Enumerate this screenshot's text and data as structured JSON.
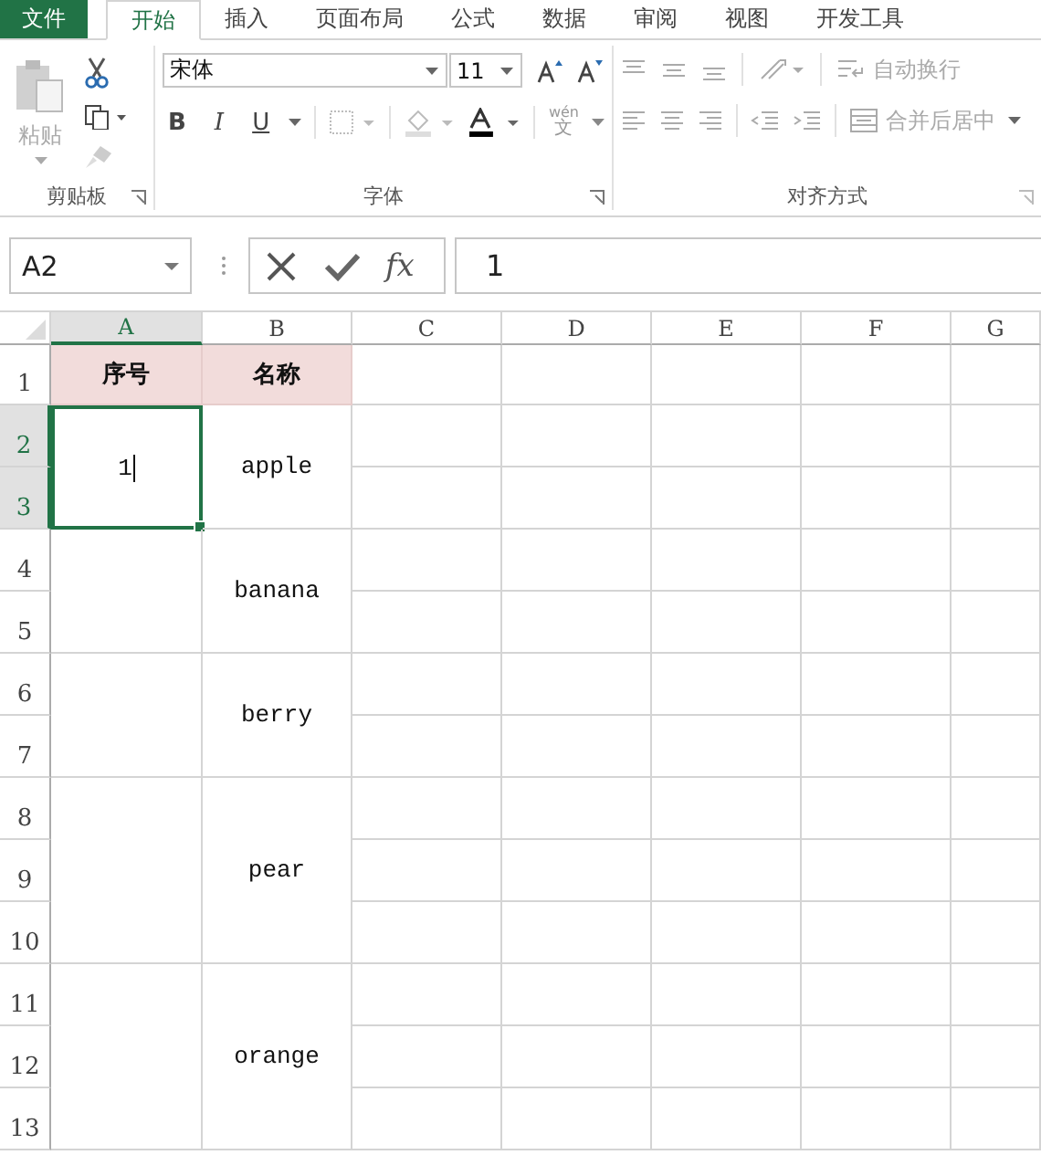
{
  "tabs": [
    {
      "label": "文件",
      "kind": "file",
      "selected": false
    },
    {
      "label": "开始",
      "kind": "tab",
      "selected": true
    },
    {
      "label": "插入",
      "kind": "tab",
      "selected": false
    },
    {
      "label": "页面布局",
      "kind": "tab",
      "selected": false
    },
    {
      "label": "公式",
      "kind": "tab",
      "selected": false
    },
    {
      "label": "数据",
      "kind": "tab",
      "selected": false
    },
    {
      "label": "审阅",
      "kind": "tab",
      "selected": false
    },
    {
      "label": "视图",
      "kind": "tab",
      "selected": false
    },
    {
      "label": "开发工具",
      "kind": "tab",
      "selected": false
    }
  ],
  "ribbon": {
    "clipboard": {
      "paste": "粘贴",
      "label": "剪贴板",
      "disabled": true
    },
    "font": {
      "name": "宋体",
      "size": "11",
      "bold": "B",
      "italic": "I",
      "underline": "U",
      "phonetic_top": "wén",
      "phonetic": "文",
      "label": "字体"
    },
    "alignment": {
      "wrap": "自动换行",
      "merge": "合并后居中",
      "label": "对齐方式",
      "disabled": true
    }
  },
  "formula_bar": {
    "name_box": "A2",
    "function_label": "fx",
    "value": "1"
  },
  "sheet": {
    "columns": [
      {
        "label": "A",
        "selected": true
      },
      {
        "label": "B",
        "selected": false
      },
      {
        "label": "C",
        "selected": false
      },
      {
        "label": "D",
        "selected": false
      },
      {
        "label": "E",
        "selected": false
      },
      {
        "label": "F",
        "selected": false
      },
      {
        "label": "G",
        "selected": false
      }
    ],
    "header_row": {
      "label": "1",
      "cells": [
        "序号",
        "名称"
      ]
    },
    "blocks": [
      {
        "rows": [
          {
            "label": "2",
            "selected": true
          },
          {
            "label": "3",
            "selected": true
          }
        ],
        "a": "1",
        "b": "apple",
        "selected": true
      },
      {
        "rows": [
          {
            "label": "4",
            "selected": false
          },
          {
            "label": "5",
            "selected": false
          }
        ],
        "b": "banana",
        "selected": false
      },
      {
        "rows": [
          {
            "label": "6",
            "selected": false
          },
          {
            "label": "7",
            "selected": false
          }
        ],
        "b": "berry",
        "selected": false
      },
      {
        "rows": [
          {
            "label": "8",
            "selected": false
          },
          {
            "label": "9",
            "selected": false
          },
          {
            "label": "10",
            "selected": false
          }
        ],
        "b": "pear",
        "selected": false
      },
      {
        "rows": [
          {
            "label": "11",
            "selected": false
          },
          {
            "label": "12",
            "selected": false
          },
          {
            "label": "13",
            "selected": false
          }
        ],
        "b": "orange",
        "selected": false
      }
    ]
  }
}
